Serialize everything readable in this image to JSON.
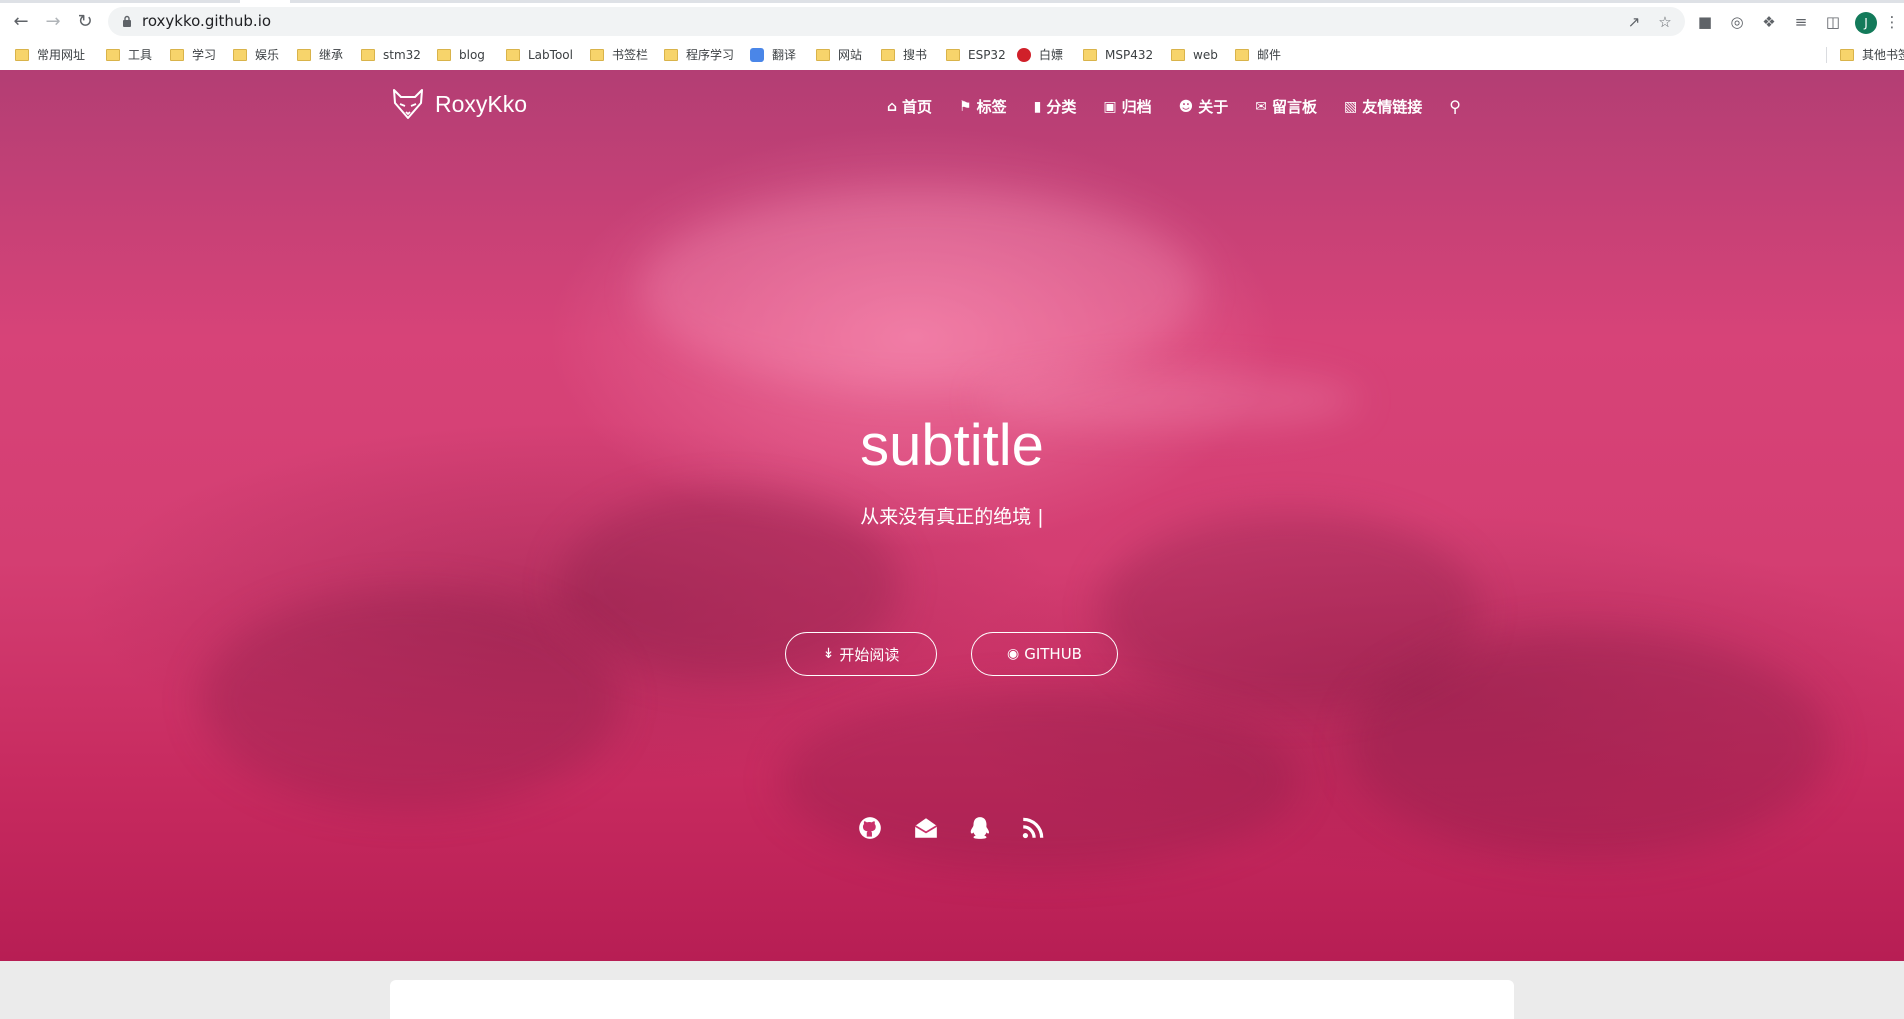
{
  "browser": {
    "url": "roxykko.github.io",
    "profile_initial": "J",
    "bookmarks": [
      "常用网址",
      "工具",
      "学习",
      "娱乐",
      "继承",
      "stm32",
      "blog",
      "LabTool",
      "书签栏",
      "程序学习",
      "翻译",
      "网站",
      "搜书",
      "ESP32",
      "白嫖",
      "MSP432",
      "web",
      "邮件"
    ],
    "other_bookmarks": "其他书签"
  },
  "site": {
    "logo_text": "RoxyKko",
    "nav": [
      {
        "label": "首页",
        "icon": "home-icon"
      },
      {
        "label": "标签",
        "icon": "tags-icon"
      },
      {
        "label": "分类",
        "icon": "bookmark-icon"
      },
      {
        "label": "归档",
        "icon": "archive-icon"
      },
      {
        "label": "关于",
        "icon": "user-circle-icon"
      },
      {
        "label": "留言板",
        "icon": "comments-icon"
      },
      {
        "label": "友情链接",
        "icon": "address-book-icon"
      }
    ],
    "hero": {
      "title": "subtitle",
      "subtitle": "从来没有真正的绝境 |",
      "read_button": "开始阅读",
      "github_button": "GITHUB"
    },
    "socials": [
      "github-icon",
      "envelope-open-icon",
      "qq-icon",
      "rss-icon"
    ]
  },
  "colors": {
    "hero_pink": "#d43e72",
    "hero_dark": "#b71e54",
    "page_bg": "#ebebeb"
  }
}
